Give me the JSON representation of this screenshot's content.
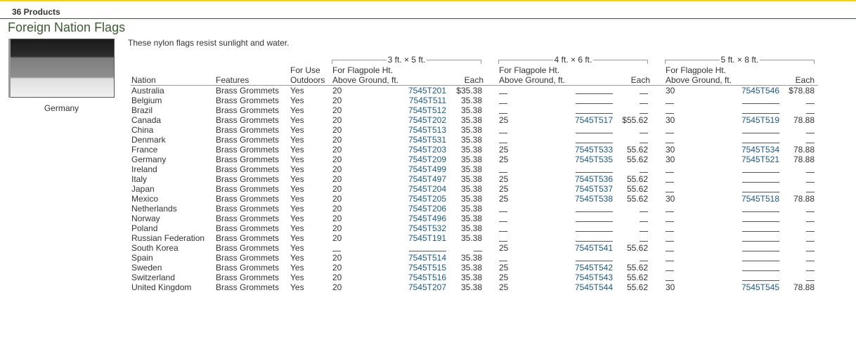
{
  "product_count": "36 Products",
  "title": "Foreign Nation Flags",
  "image": {
    "caption": "Germany",
    "stripe_colors": [
      "#1a1a1a",
      "#8a8a8a",
      "#efefef"
    ]
  },
  "description": "These nylon flags resist sunlight and water.",
  "groups": [
    {
      "size": "3 ft. × 5 ft.",
      "col_height": "For Flagpole Ht. Above Ground, ft.",
      "col_each": "Each"
    },
    {
      "size": "4 ft. × 6 ft.",
      "col_height": "For Flagpole Ht. Above Ground, ft.",
      "col_each": "Each"
    },
    {
      "size": "5 ft. × 8 ft.",
      "col_height": "For Flagpole Ht. Above Ground, ft.",
      "col_each": "Each"
    }
  ],
  "headers": {
    "nation": "Nation",
    "features": "Features",
    "outdoors_1": "For Use",
    "outdoors_2": "Outdoors",
    "height_1": "For Flagpole Ht.",
    "height_2": "Above Ground, ft.",
    "each": "Each"
  },
  "rows": [
    {
      "nation": "Australia",
      "features": "Brass Grommets",
      "outdoors": "Yes",
      "g1": {
        "ht": "20",
        "part": "7545T201",
        "price": "$35.38"
      },
      "g2": null,
      "g3": {
        "ht": "30",
        "part": "7545T546",
        "price": "$78.88"
      }
    },
    {
      "nation": "Belgium",
      "features": "Brass Grommets",
      "outdoors": "Yes",
      "g1": {
        "ht": "20",
        "part": "7545T511",
        "price": "35.38"
      },
      "g2": null,
      "g3": null
    },
    {
      "nation": "Brazil",
      "features": "Brass Grommets",
      "outdoors": "Yes",
      "g1": {
        "ht": "20",
        "part": "7545T512",
        "price": "35.38"
      },
      "g2": null,
      "g3": null
    },
    {
      "nation": "Canada",
      "features": "Brass Grommets",
      "outdoors": "Yes",
      "g1": {
        "ht": "20",
        "part": "7545T202",
        "price": "35.38"
      },
      "g2": {
        "ht": "25",
        "part": "7545T517",
        "price": "$55.62"
      },
      "g3": {
        "ht": "30",
        "part": "7545T519",
        "price": "78.88"
      }
    },
    {
      "nation": "China",
      "features": "Brass Grommets",
      "outdoors": "Yes",
      "g1": {
        "ht": "20",
        "part": "7545T513",
        "price": "35.38"
      },
      "g2": null,
      "g3": null
    },
    {
      "nation": "Denmark",
      "features": "Brass Grommets",
      "outdoors": "Yes",
      "g1": {
        "ht": "20",
        "part": "7545T531",
        "price": "35.38"
      },
      "g2": null,
      "g3": null
    },
    {
      "nation": "France",
      "features": "Brass Grommets",
      "outdoors": "Yes",
      "g1": {
        "ht": "20",
        "part": "7545T203",
        "price": "35.38"
      },
      "g2": {
        "ht": "25",
        "part": "7545T533",
        "price": "55.62"
      },
      "g3": {
        "ht": "30",
        "part": "7545T534",
        "price": "78.88"
      }
    },
    {
      "nation": "Germany",
      "features": "Brass Grommets",
      "outdoors": "Yes",
      "g1": {
        "ht": "20",
        "part": "7545T209",
        "price": "35.38"
      },
      "g2": {
        "ht": "25",
        "part": "7545T535",
        "price": "55.62"
      },
      "g3": {
        "ht": "30",
        "part": "7545T521",
        "price": "78.88"
      }
    },
    {
      "nation": "Ireland",
      "features": "Brass Grommets",
      "outdoors": "Yes",
      "g1": {
        "ht": "20",
        "part": "7545T499",
        "price": "35.38"
      },
      "g2": null,
      "g3": null
    },
    {
      "nation": "Italy",
      "features": "Brass Grommets",
      "outdoors": "Yes",
      "g1": {
        "ht": "20",
        "part": "7545T497",
        "price": "35.38"
      },
      "g2": {
        "ht": "25",
        "part": "7545T536",
        "price": "55.62"
      },
      "g3": null
    },
    {
      "nation": "Japan",
      "features": "Brass Grommets",
      "outdoors": "Yes",
      "g1": {
        "ht": "20",
        "part": "7545T204",
        "price": "35.38"
      },
      "g2": {
        "ht": "25",
        "part": "7545T537",
        "price": "55.62"
      },
      "g3": null
    },
    {
      "nation": "Mexico",
      "features": "Brass Grommets",
      "outdoors": "Yes",
      "g1": {
        "ht": "20",
        "part": "7545T205",
        "price": "35.38"
      },
      "g2": {
        "ht": "25",
        "part": "7545T538",
        "price": "55.62"
      },
      "g3": {
        "ht": "30",
        "part": "7545T518",
        "price": "78.88"
      }
    },
    {
      "nation": "Netherlands",
      "features": "Brass Grommets",
      "outdoors": "Yes",
      "g1": {
        "ht": "20",
        "part": "7545T206",
        "price": "35.38"
      },
      "g2": null,
      "g3": null
    },
    {
      "nation": "Norway",
      "features": "Brass Grommets",
      "outdoors": "Yes",
      "g1": {
        "ht": "20",
        "part": "7545T496",
        "price": "35.38"
      },
      "g2": null,
      "g3": null
    },
    {
      "nation": "Poland",
      "features": "Brass Grommets",
      "outdoors": "Yes",
      "g1": {
        "ht": "20",
        "part": "7545T532",
        "price": "35.38"
      },
      "g2": null,
      "g3": null
    },
    {
      "nation": "Russian Federation",
      "features": "Brass Grommets",
      "outdoors": "Yes",
      "g1": {
        "ht": "20",
        "part": "7545T191",
        "price": "35.38"
      },
      "g2": null,
      "g3": null
    },
    {
      "nation": "South Korea",
      "features": "Brass Grommets",
      "outdoors": "Yes",
      "g1": null,
      "g2": {
        "ht": "25",
        "part": "7545T541",
        "price": "55.62"
      },
      "g3": null
    },
    {
      "nation": "Spain",
      "features": "Brass Grommets",
      "outdoors": "Yes",
      "g1": {
        "ht": "20",
        "part": "7545T514",
        "price": "35.38"
      },
      "g2": null,
      "g3": null
    },
    {
      "nation": "Sweden",
      "features": "Brass Grommets",
      "outdoors": "Yes",
      "g1": {
        "ht": "20",
        "part": "7545T515",
        "price": "35.38"
      },
      "g2": {
        "ht": "25",
        "part": "7545T542",
        "price": "55.62"
      },
      "g3": null
    },
    {
      "nation": "Switzerland",
      "features": "Brass Grommets",
      "outdoors": "Yes",
      "g1": {
        "ht": "20",
        "part": "7545T516",
        "price": "35.38"
      },
      "g2": {
        "ht": "25",
        "part": "7545T543",
        "price": "55.62"
      },
      "g3": null
    },
    {
      "nation": "United Kingdom",
      "features": "Brass Grommets",
      "outdoors": "Yes",
      "g1": {
        "ht": "20",
        "part": "7545T207",
        "price": "35.38"
      },
      "g2": {
        "ht": "25",
        "part": "7545T544",
        "price": "55.62"
      },
      "g3": {
        "ht": "30",
        "part": "7545T545",
        "price": "78.88"
      }
    }
  ]
}
